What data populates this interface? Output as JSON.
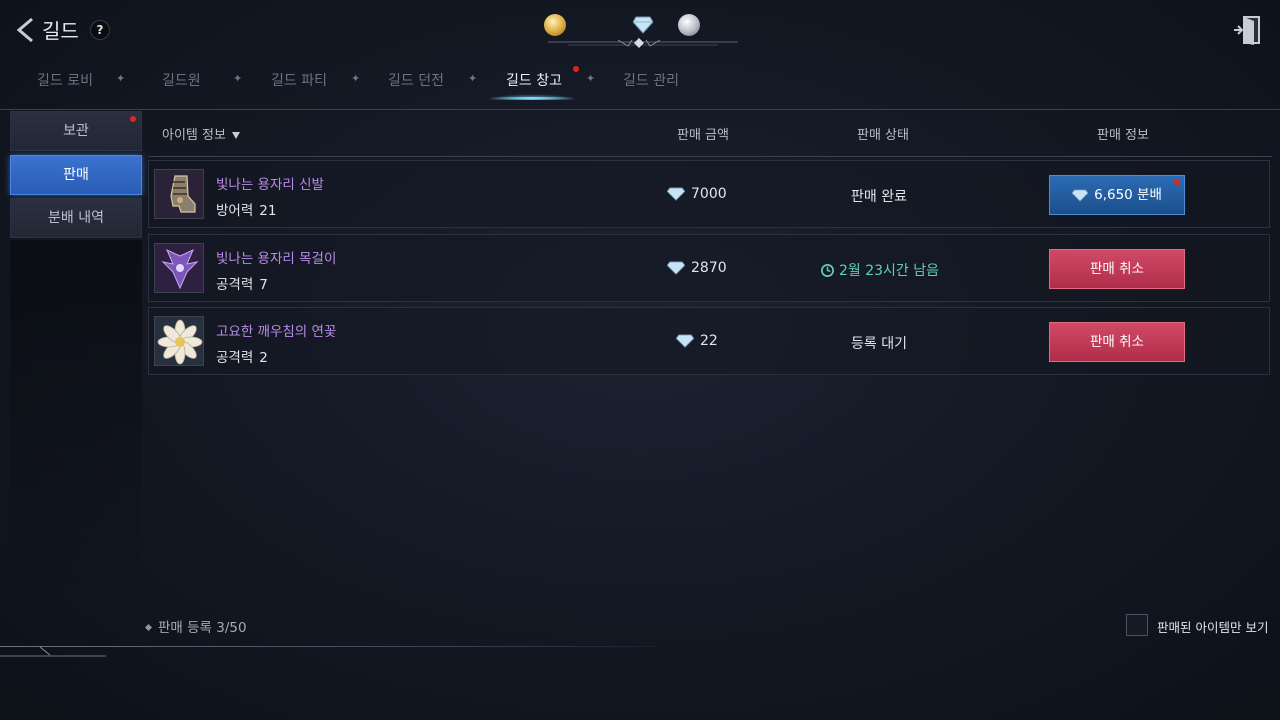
{
  "header": {
    "title": "길드",
    "help_label": "?"
  },
  "tabs": [
    {
      "label": "길드 로비",
      "active": false
    },
    {
      "label": "길드원",
      "active": false
    },
    {
      "label": "길드 파티",
      "active": false
    },
    {
      "label": "길드 던전",
      "active": false
    },
    {
      "label": "길드 창고",
      "active": true,
      "badge": true
    },
    {
      "label": "길드 관리",
      "active": false
    }
  ],
  "sidebar": {
    "items": [
      {
        "label": "보관",
        "active": false,
        "badge": true
      },
      {
        "label": "판매",
        "active": true
      },
      {
        "label": "분배 내역",
        "active": false
      }
    ]
  },
  "table": {
    "headers": {
      "item_info": "아이템 정보",
      "sale_price": "판매 금액",
      "sale_status": "판매 상태",
      "sale_info": "판매 정보"
    },
    "rows": [
      {
        "name": "빛나는 용자리 신발",
        "stat_label": "방어력",
        "stat_value": "21",
        "price": "7000",
        "status": "판매 완료",
        "action_label": "6,650 분배",
        "action_type": "distribute",
        "icon": "boots-icon"
      },
      {
        "name": "빛나는 용자리 목걸이",
        "stat_label": "공격력",
        "stat_value": "7",
        "price": "2870",
        "status": "2월 23시간 남음",
        "action_label": "판매 취소",
        "action_type": "cancel",
        "icon": "necklace-icon"
      },
      {
        "name": "고요한 깨우침의 연꽃",
        "stat_label": "공격력",
        "stat_value": "2",
        "price": "22",
        "status": "등록 대기",
        "action_label": "판매 취소",
        "action_type": "cancel",
        "icon": "lotus-icon"
      }
    ]
  },
  "footer": {
    "registration": "판매 등록 3/50",
    "sold_only_label": "판매된 아이템만 보기",
    "sold_only_checked": false
  },
  "colors": {
    "item_name": "#b88bea",
    "timer": "#5fd0b6",
    "active_tab_glow": "#7fdcff",
    "badge": "#e0251f"
  }
}
